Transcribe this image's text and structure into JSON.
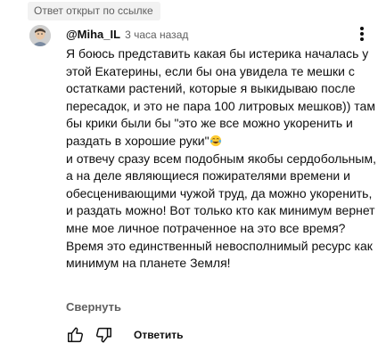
{
  "badge": {
    "label": "Ответ открыт по ссылке"
  },
  "comment": {
    "author": "@Miha_IL",
    "time": "3 часа назад",
    "paragraphs": [
      "Я боюсь представить какая бы истерика началась у этой Екатерины, если бы она увидела те мешки с остатками растений, которые я выкидываю после пересадок, и это не пара 100 литровых мешков)) там бы крики были бы \"это же все можно укоренить и раздать в хорошие руки\"",
      "и отвечу сразу всем подобным якобы сердобольным, а на деле являющиеся пожирателями времени и обесценивающими чужой труд, да можно укоренить, и раздать можно! Вот только кто как минимум вернет мне мое личное потраченное на это все время? Время это единственный невосполнимый ресурс как минимум на планете Земля!"
    ],
    "emoji_icon": "laughing-tears-emoji",
    "collapse_label": "Свернуть"
  },
  "actions": {
    "like_icon": "thumbs-up-icon",
    "dislike_icon": "thumbs-down-icon",
    "reply_label": "Ответить"
  },
  "menu": {
    "icon": "more-vertical-icon"
  },
  "colors": {
    "text": "#0f0f0f",
    "secondary": "#606060",
    "badge_bg": "#f2f2f2"
  }
}
